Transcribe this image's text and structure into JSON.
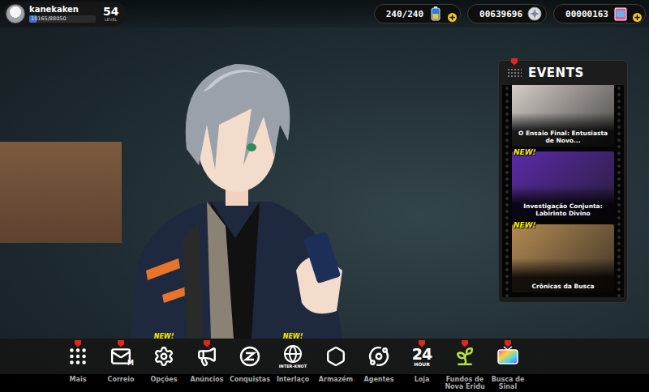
{
  "player": {
    "name": "kanekaken",
    "xp": "10165/88050",
    "xp_level": 0.115,
    "level": "54",
    "level_label": "LEVEL"
  },
  "currencies": [
    {
      "value": "240/240",
      "kind": "battery",
      "addable": true
    },
    {
      "value": "00639696",
      "kind": "coin",
      "addable": false
    },
    {
      "value": "00000163",
      "kind": "film",
      "addable": true
    }
  ],
  "events": {
    "title": "EVENTS",
    "badge": true,
    "items": [
      {
        "caption": "O Ensaio Final: Entusiasta de Novo...",
        "tag": "",
        "color": "#d9d2cc"
      },
      {
        "caption": "Investigação Conjunta: Labirinto Divino",
        "tag": "NEW!",
        "color": "#5b2aa8"
      },
      {
        "caption": "Crônicas da Busca",
        "tag": "NEW!",
        "color": "#b38a52"
      }
    ]
  },
  "nav": [
    {
      "label": "Mais",
      "kind": "grid",
      "badge": true,
      "tag": "",
      "icon_text": []
    },
    {
      "label": "Correio",
      "kind": "mail",
      "badge": true,
      "tag": "",
      "icon_text": [
        "M"
      ]
    },
    {
      "label": "Opções",
      "kind": "gear",
      "badge": false,
      "tag": "NEW!",
      "icon_text": []
    },
    {
      "label": "Anúncios",
      "kind": "megaphone",
      "badge": true,
      "tag": "",
      "icon_text": []
    },
    {
      "label": "Conquistas",
      "kind": "zzz",
      "badge": false,
      "tag": "",
      "icon_text": []
    },
    {
      "label": "Interlaço",
      "kind": "globe",
      "badge": false,
      "tag": "NEW!",
      "icon_text": [
        "INTER-KNOT"
      ]
    },
    {
      "label": "Armazém",
      "kind": "hexagon",
      "badge": false,
      "tag": "",
      "icon_text": []
    },
    {
      "label": "Agentes",
      "kind": "orbit",
      "badge": false,
      "tag": "",
      "icon_text": []
    },
    {
      "label": "Loja",
      "kind": "clock24",
      "badge": true,
      "tag": "",
      "icon_text": [
        "24",
        "HOUR"
      ]
    },
    {
      "label": "Fundos de Nova Eridu",
      "kind": "sprout",
      "badge": true,
      "tag": "",
      "icon_text": []
    },
    {
      "label": "Busca de Sinal",
      "kind": "tv",
      "badge": true,
      "tag": "",
      "icon_text": []
    }
  ]
}
